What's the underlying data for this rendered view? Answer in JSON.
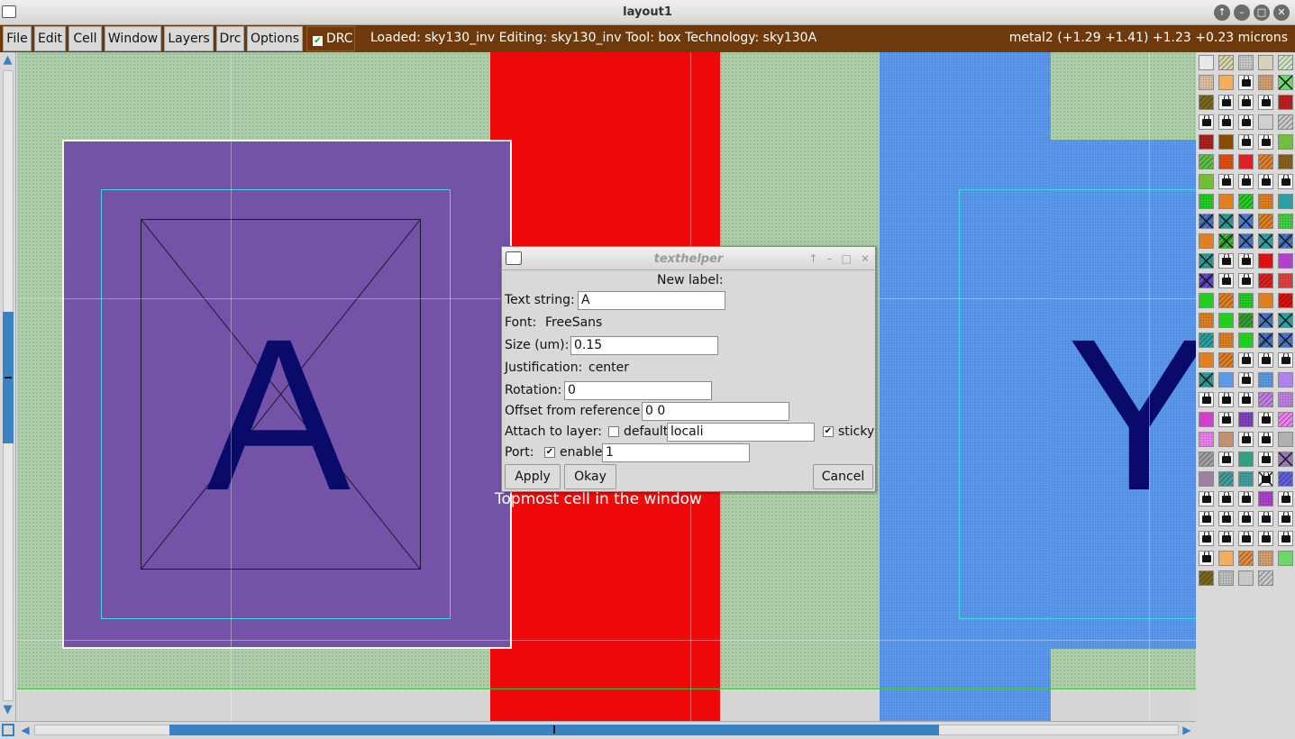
{
  "window": {
    "title": "layout1",
    "controls": [
      "↑",
      "–",
      "□",
      "✕"
    ]
  },
  "menubar": {
    "items": [
      "File",
      "Edit",
      "Cell",
      "Window",
      "Layers",
      "Drc",
      "Options"
    ],
    "drc_label": "DRC",
    "drc_checked": true,
    "status": "Loaded: sky130_inv Editing: sky130_inv Tool: box  Technology: sky130A",
    "coords": "metal2   (+1.29 +1.41) +1.23 +0.23 microns"
  },
  "canvas": {
    "cell_label": "Topmost cell in the window",
    "letter_a": "A",
    "letter_y": "Y",
    "colors": {
      "background": "#aecdaa",
      "poly": "#ee0a0a",
      "metal": "#7352a8",
      "diffusion": "#5c99ea",
      "text": "#0a0a6a"
    }
  },
  "dialog": {
    "title": "texthelper",
    "heading": "New label:",
    "text_string_label": "Text string:",
    "text_string_value": "A",
    "font_label": "Font:",
    "font_value": "FreeSans",
    "size_label": "Size (um):",
    "size_value": "0.15",
    "justification_label": "Justification:",
    "justification_value": "center",
    "rotation_label": "Rotation:",
    "rotation_value": "0",
    "offset_label": "Offset from reference:",
    "offset_value": "0 0",
    "attach_label": "Attach to layer:",
    "default_label": "default",
    "default_checked": false,
    "layer_value": "locali",
    "sticky_label": "sticky",
    "sticky_checked": true,
    "port_label": "Port:",
    "enable_label": "enable",
    "enable_checked": true,
    "port_value": "1",
    "apply_label": "Apply",
    "okay_label": "Okay",
    "cancel_label": "Cancel"
  },
  "palette": {
    "layer_count": 116
  }
}
